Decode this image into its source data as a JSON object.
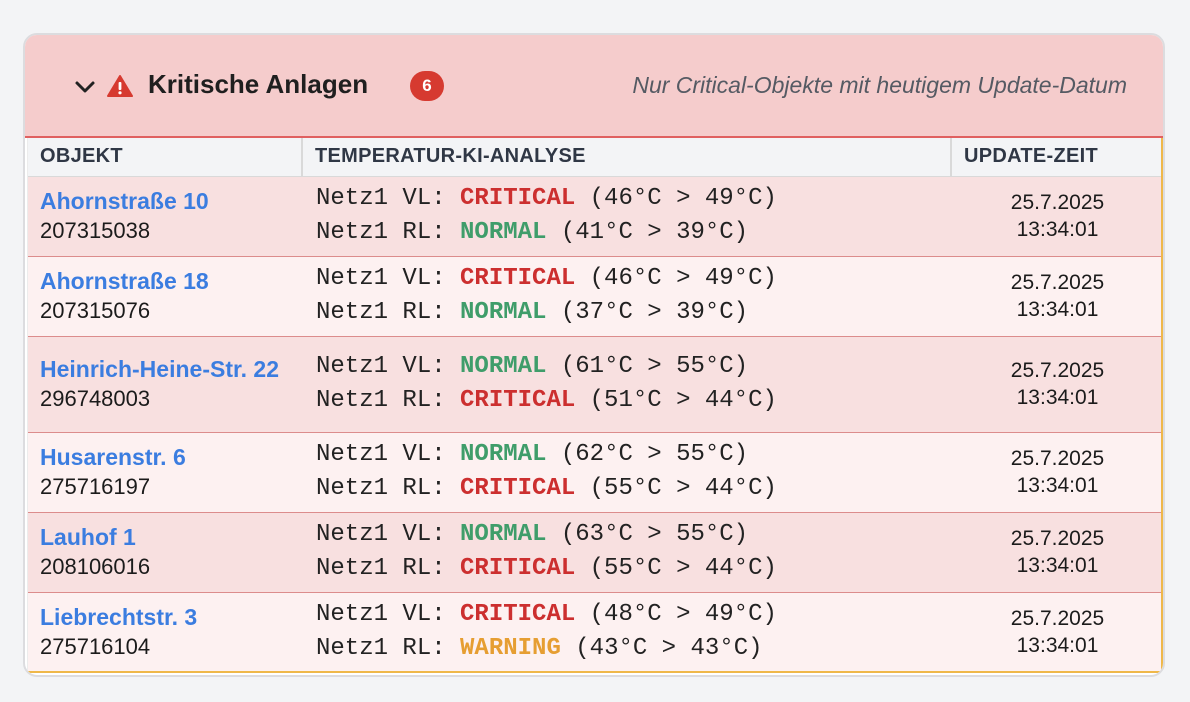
{
  "panel": {
    "title": "Kritische Anlagen",
    "count": "6",
    "hint": "Nur Critical-Objekte mit heutigem Update-Datum",
    "icons": {
      "toggle": "chevron-down-icon",
      "alert": "warning-triangle-icon"
    },
    "colors": {
      "critical": "#cc2f2f",
      "normal": "#3f9d6a",
      "warning": "#e69e32",
      "link": "#3b7de0",
      "header_bg": "#f5cccc"
    }
  },
  "table": {
    "headers": [
      "OBJEKT",
      "TEMPERATUR-KI-ANALYSE",
      "UPDATE-ZEIT"
    ],
    "rows": [
      {
        "name": "Ahornstraße 10",
        "id": "207315038",
        "vl": {
          "prefix": "Netz1 VL: ",
          "status": "CRITICAL",
          "detail": " (46°C > 49°C)"
        },
        "rl": {
          "prefix": "Netz1 RL: ",
          "status": "NORMAL",
          "detail": " (41°C > 39°C)"
        },
        "date": "25.7.2025",
        "time": "13:34:01"
      },
      {
        "name": "Ahornstraße 18",
        "id": "207315076",
        "vl": {
          "prefix": "Netz1 VL: ",
          "status": "CRITICAL",
          "detail": " (46°C > 49°C)"
        },
        "rl": {
          "prefix": "Netz1 RL: ",
          "status": "NORMAL",
          "detail": " (37°C > 39°C)"
        },
        "date": "25.7.2025",
        "time": "13:34:01"
      },
      {
        "name": "Heinrich-Heine-Str. 22",
        "id": "296748003",
        "vl": {
          "prefix": "Netz1 VL: ",
          "status": "NORMAL",
          "detail": " (61°C > 55°C)"
        },
        "rl": {
          "prefix": "Netz1 RL: ",
          "status": "CRITICAL",
          "detail": " (51°C > 44°C)"
        },
        "date": "25.7.2025",
        "time": "13:34:01"
      },
      {
        "name": "Husarenstr. 6",
        "id": "275716197",
        "vl": {
          "prefix": "Netz1 VL: ",
          "status": "NORMAL",
          "detail": " (62°C > 55°C)"
        },
        "rl": {
          "prefix": "Netz1 RL: ",
          "status": "CRITICAL",
          "detail": " (55°C > 44°C)"
        },
        "date": "25.7.2025",
        "time": "13:34:01"
      },
      {
        "name": "Lauhof 1",
        "id": "208106016",
        "vl": {
          "prefix": "Netz1 VL: ",
          "status": "NORMAL",
          "detail": " (63°C > 55°C)"
        },
        "rl": {
          "prefix": "Netz1 RL: ",
          "status": "CRITICAL",
          "detail": " (55°C > 44°C)"
        },
        "date": "25.7.2025",
        "time": "13:34:01"
      },
      {
        "name": "Liebrechtstr. 3",
        "id": "275716104",
        "vl": {
          "prefix": "Netz1 VL: ",
          "status": "CRITICAL",
          "detail": " (48°C > 49°C)"
        },
        "rl": {
          "prefix": "Netz1 RL: ",
          "status": "WARNING",
          "detail": " (43°C > 43°C)"
        },
        "date": "25.7.2025",
        "time": "13:34:01"
      }
    ]
  }
}
